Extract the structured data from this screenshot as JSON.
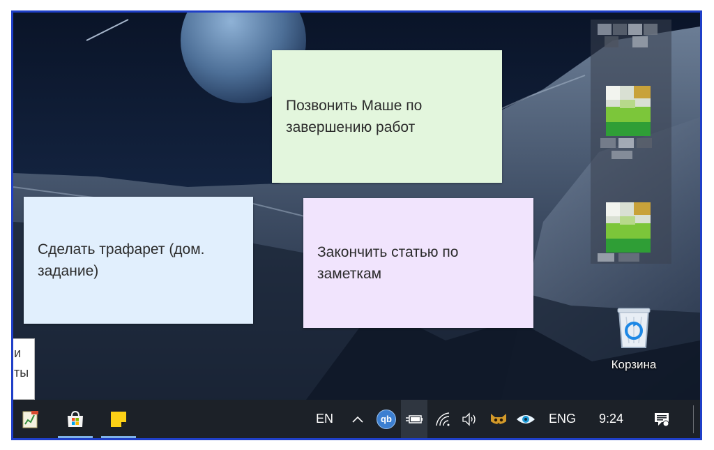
{
  "notes": [
    {
      "text_line1": "Позвонить Маше по",
      "text_line2": "завершению работ",
      "color": "#e3f6dd"
    },
    {
      "text_line1": "Сделать трафарет (дом.",
      "text_line2": "задание)",
      "color": "#e1effd"
    },
    {
      "text_line1": "Закончить статью по",
      "text_line2": "заметкам",
      "color": "#f1e4fd"
    }
  ],
  "partial_window": {
    "line1": "и",
    "line2": "ты"
  },
  "desktop": {
    "recycle_bin_label": "Корзина",
    "pixelated_icons": [
      "blurred-file-icon",
      "blurred-file-icon"
    ]
  },
  "taskbar": {
    "pinned": [
      {
        "name": "notepad-chart-app-icon"
      },
      {
        "name": "microsoft-store-icon"
      },
      {
        "name": "sticky-notes-icon"
      }
    ],
    "input_lang_short": "EN",
    "input_lang": "ENG",
    "qb_label": "qb",
    "clock": "9:24",
    "accent_color": "#7fb3e8"
  }
}
